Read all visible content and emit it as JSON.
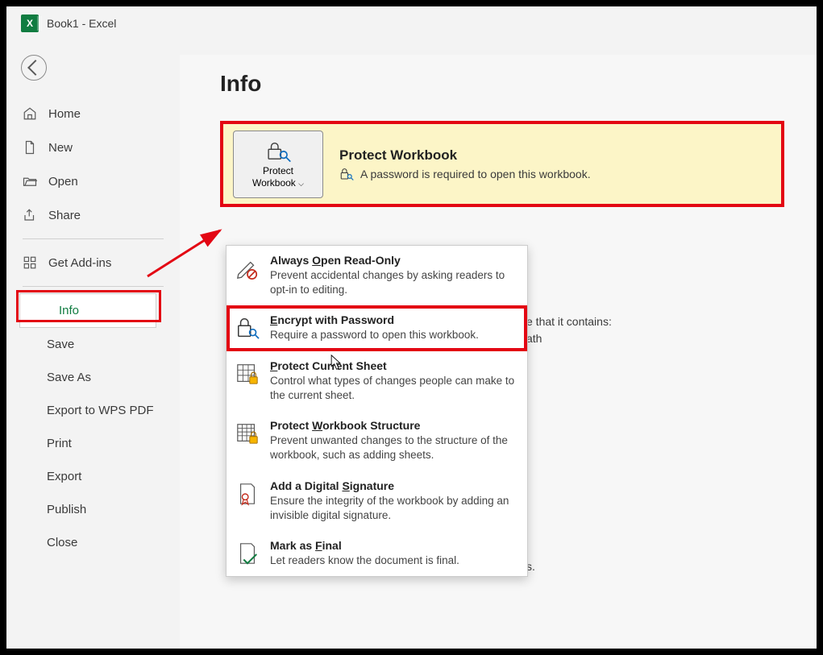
{
  "titlebar": {
    "title": "Book1  -  Excel"
  },
  "sidebar": {
    "home": "Home",
    "new": "New",
    "open": "Open",
    "share": "Share",
    "get_addins": "Get Add-ins",
    "info": "Info",
    "save": "Save",
    "save_as": "Save As",
    "export_wps": "Export to WPS PDF",
    "print": "Print",
    "export": "Export",
    "publish": "Publish",
    "close": "Close"
  },
  "main": {
    "page_title": "Info",
    "protect": {
      "button_line1": "Protect",
      "button_line2": "Workbook",
      "heading": "Protect Workbook",
      "message": "A password is required to open this workbook."
    },
    "behind_fragment1": "e that it contains:",
    "behind_fragment2": "ath",
    "behind_fragment3": "s."
  },
  "dropdown": [
    {
      "title_pre": "Always ",
      "title_u": "O",
      "title_post": "pen Read-Only",
      "desc": "Prevent accidental changes by asking readers to opt-in to editing."
    },
    {
      "title_pre": "",
      "title_u": "E",
      "title_post": "ncrypt with Password",
      "desc": "Require a password to open this workbook."
    },
    {
      "title_pre": "",
      "title_u": "P",
      "title_post": "rotect Current Sheet",
      "desc": "Control what types of changes people can make to the current sheet."
    },
    {
      "title_pre": "Protect ",
      "title_u": "W",
      "title_post": "orkbook Structure",
      "desc": "Prevent unwanted changes to the structure of the workbook, such as adding sheets."
    },
    {
      "title_pre": "Add a Digital ",
      "title_u": "S",
      "title_post": "ignature",
      "desc": "Ensure the integrity of the workbook by adding an invisible digital signature."
    },
    {
      "title_pre": "Mark as ",
      "title_u": "F",
      "title_post": "inal",
      "desc": "Let readers know the document is final."
    }
  ]
}
